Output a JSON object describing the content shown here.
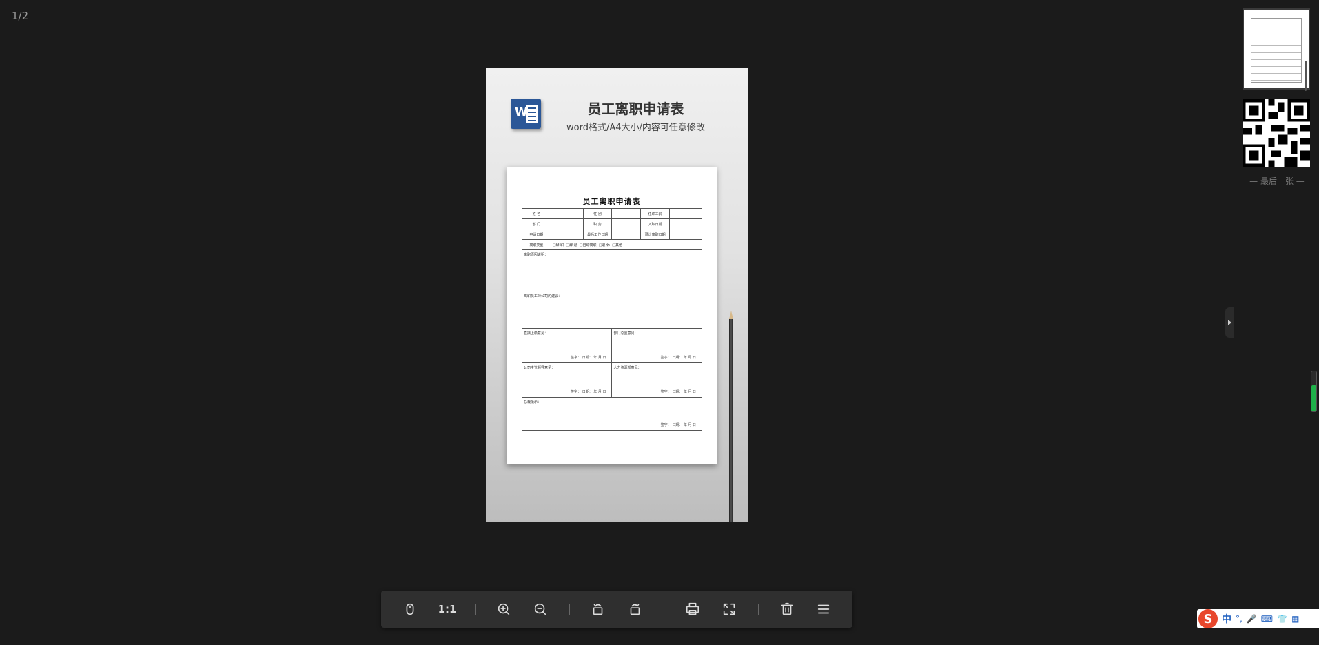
{
  "viewer": {
    "page_counter": "1/2",
    "last_label": "— 最后一张 —"
  },
  "document": {
    "header_title": "员工离职申请表",
    "header_subtitle": "word格式/A4大小/内容可任意修改",
    "form_title": "员工离职申请表",
    "rows": [
      [
        "姓 名",
        "",
        "性 别",
        "",
        "任职工龄",
        ""
      ],
      [
        "部 门",
        "",
        "职 务",
        "",
        "入职日期",
        ""
      ],
      [
        "申请日期",
        "",
        "最后工作日期",
        "",
        "预计离职日期",
        ""
      ]
    ],
    "type_label": "离职类型",
    "type_options": [
      "□辞 职",
      "□辞 退",
      "□自动离职",
      "□退 休",
      "□其他"
    ],
    "reason_label": "离职原因说明：",
    "suggest_label": "离职员工对公司的建议：",
    "direct_label": "直接上级意见：",
    "dept_label": "部门总监意见：",
    "gm_label": "公司主管领导意见：",
    "hr_label": "人力资源部意见：",
    "ceo_label": "总裁批示：",
    "sign_text": "签字：        日期：      年   月   日"
  },
  "toolbar": {
    "one_to_one": "1:1"
  },
  "ime": {
    "logo": "S",
    "lang": "中",
    "punct": "°,"
  },
  "colors": {
    "background": "#1b1b1b",
    "toolbar": "#2f2f2f",
    "word_blue": "#2b5797",
    "progress_green": "#1fb24a"
  }
}
